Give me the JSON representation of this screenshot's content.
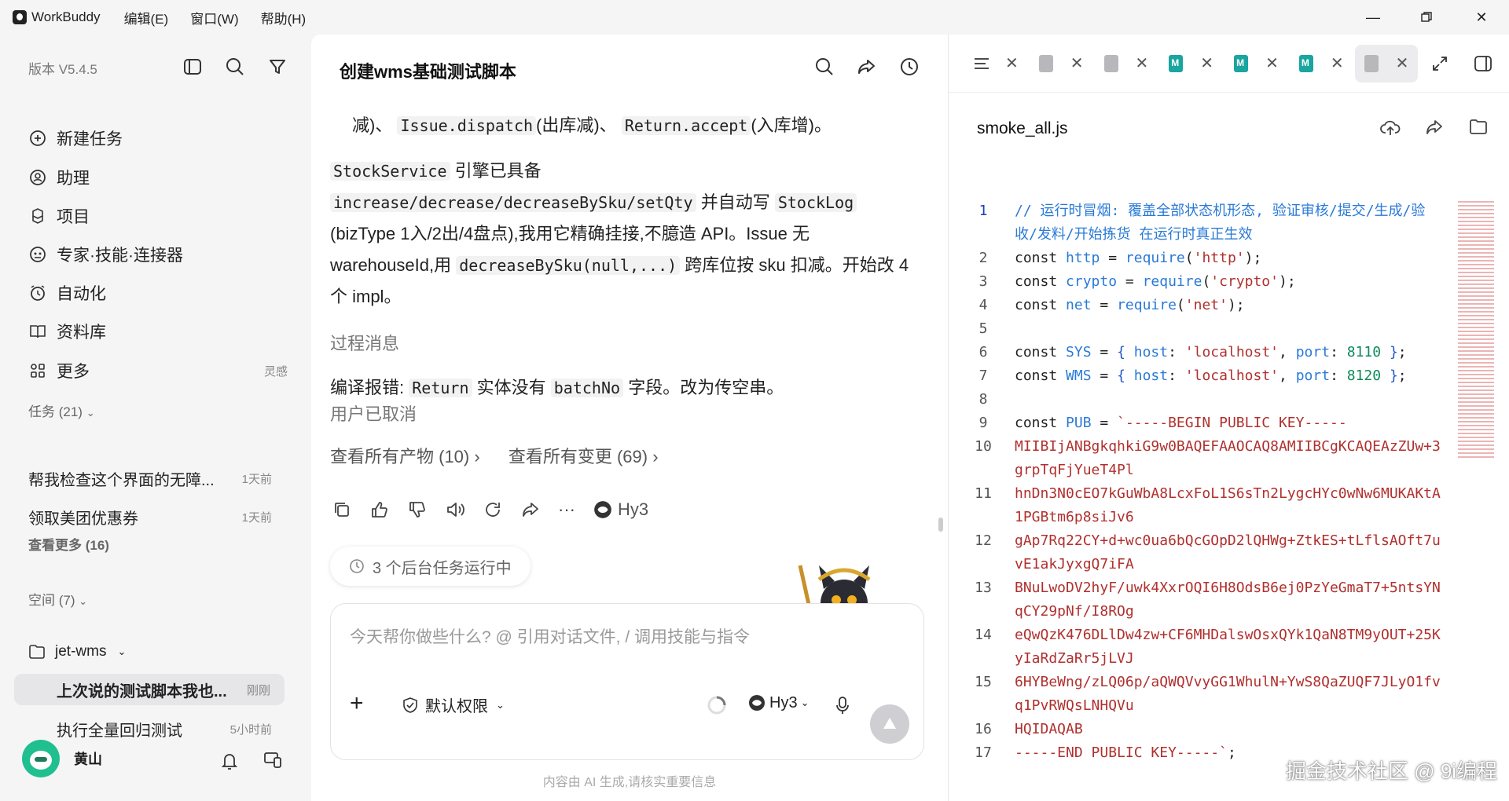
{
  "titlebar": {
    "app_name": "WorkBuddy",
    "menus": [
      "编辑(E)",
      "窗口(W)",
      "帮助(H)"
    ]
  },
  "sidebar": {
    "version": "版本 V5.4.5",
    "nav": [
      {
        "label": "新建任务",
        "icon": "plus-circle-icon"
      },
      {
        "label": "助理",
        "icon": "assistant-icon"
      },
      {
        "label": "项目",
        "icon": "project-icon"
      },
      {
        "label": "专家·技能·连接器",
        "icon": "expert-icon"
      },
      {
        "label": "自动化",
        "icon": "clock-icon"
      },
      {
        "label": "资料库",
        "icon": "book-icon"
      },
      {
        "label": "更多",
        "icon": "grid-icon",
        "right": "灵感"
      }
    ],
    "tasks_header": "任务 (21)",
    "tasks": [
      {
        "title": "帮我检查这个界面的无障...",
        "time": "1天前"
      },
      {
        "title": "领取美团优惠券",
        "time": "1天前"
      }
    ],
    "see_more": "查看更多 (16)",
    "spaces_header": "空间 (7)",
    "space": "jet-wms",
    "space_tasks": [
      {
        "title": "上次说的测试脚本我也...",
        "time": "刚刚"
      },
      {
        "title": "执行全量回归测试",
        "time": "5小时前"
      }
    ],
    "user": "黄山"
  },
  "chat": {
    "title": "创建wms基础测试脚本",
    "p1_a": "减)、",
    "p1_c1": "Issue.dispatch",
    "p1_b": "(出库减)、",
    "p1_c2": "Return.accept",
    "p1_d": "(入库增)。",
    "p2_c1": "StockService",
    "p2_a": "引擎已具备",
    "p2_c2": "increase/decrease/decreaseBySku/setQty",
    "p2_b": "并自动写",
    "p2_c3": "StockLog",
    "p2_c": "(bizType 1入/2出/4盘点),我用它精确挂接,不臆造 API。Issue 无 warehouseId,用",
    "p2_c4": "decreaseBySku(null,...)",
    "p2_d": "跨库位按 sku 扣减。开始改 4 个 impl。",
    "process": "过程消息",
    "err_a": "编译报错:",
    "err_c1": "Return",
    "err_b": "实体没有",
    "err_c2": "batchNo",
    "err_c": "字段。改为传空串。",
    "cancelled": "用户已取消",
    "link_products": "查看所有产物 (10)",
    "link_changes": "查看所有变更 (69)",
    "model": "Hy3",
    "bg_tasks": "3 个后台任务运行中",
    "input_placeholder": "今天帮你做些什么? @ 引用对话文件, / 调用技能与指令",
    "permission": "默认权限",
    "footnote": "内容由 AI 生成,请核实重要信息"
  },
  "editor": {
    "filename": "smoke_all.js",
    "lines": [
      {
        "n": "1",
        "cur": true,
        "html": "<span class='cmt'>// 运行时冒烟: 覆盖全部状态机形态, 验证审核/提交/生成/验收/发料/开始拣货 在运行时真正生效</span>"
      },
      {
        "n": "2",
        "html": "<span class='kw'>const</span> <span class='var'>http</span> = <span class='var'>require</span>(<span class='str'>'http'</span>);"
      },
      {
        "n": "3",
        "html": "<span class='kw'>const</span> <span class='var'>crypto</span> = <span class='var'>require</span>(<span class='str'>'crypto'</span>);"
      },
      {
        "n": "4",
        "html": "<span class='kw'>const</span> <span class='var'>net</span> = <span class='var'>require</span>(<span class='str'>'net'</span>);"
      },
      {
        "n": "5",
        "html": " "
      },
      {
        "n": "6",
        "html": "<span class='kw'>const</span> <span class='var'>SYS</span> = <span class='br'>{</span> <span class='var'>host</span>: <span class='str'>'localhost'</span>, <span class='var'>port</span>: <span class='num'>8110</span> <span class='br'>}</span>;"
      },
      {
        "n": "7",
        "html": "<span class='kw'>const</span> <span class='var'>WMS</span> = <span class='br'>{</span> <span class='var'>host</span>: <span class='str'>'localhost'</span>, <span class='var'>port</span>: <span class='num'>8120</span> <span class='br'>}</span>;"
      },
      {
        "n": "8",
        "html": " "
      },
      {
        "n": "9",
        "html": "<span class='kw'>const</span> <span class='var'>PUB</span> = <span class='str'>`-----BEGIN PUBLIC KEY-----</span>"
      },
      {
        "n": "10",
        "html": "<span class='str'>MIIBIjANBgkqhkiG9w0BAQEFAAOCAQ8AMIIBCgKCAQEAzZUw+3grpTqFjYueT4Pl</span>"
      },
      {
        "n": "11",
        "html": "<span class='str'>hnDn3N0cEO7kGuWbA8LcxFoL1S6sTn2LygcHYc0wNw6MUKAKtA1PGBtm6p8siJv6</span>"
      },
      {
        "n": "12",
        "html": "<span class='str'>gAp7Rq22CY+d+wc0ua6bQcGOpD2lQHWg+ZtkES+tLflsAOft7uvE1akJyxgQ7iFA</span>"
      },
      {
        "n": "13",
        "html": "<span class='str'>BNuLwoDV2hyF/uwk4XxrOQI6H8OdsB6ej0PzYeGmaT7+5ntsYNqCY29pNf/I8ROg</span>"
      },
      {
        "n": "14",
        "html": "<span class='str'>eQwQzK476DLlDw4zw+CF6MHDalswOsxQYk1QaN8TM9yOUT+25KyIaRdZaRr5jLVJ</span>"
      },
      {
        "n": "15",
        "html": "<span class='str'>6HYBeWng/zLQ06p/aQWQVvyGG1WhulN+YwS8QaZUQF7JLyO1fvq1PvRWQsLNHQVu</span>"
      },
      {
        "n": "16",
        "html": "<span class='str'>HQIDAQAB</span>"
      },
      {
        "n": "17",
        "html": "<span class='str'>-----END PUBLIC KEY-----`</span>;"
      }
    ]
  },
  "watermark": "掘金技术社区 @ 9i编程"
}
